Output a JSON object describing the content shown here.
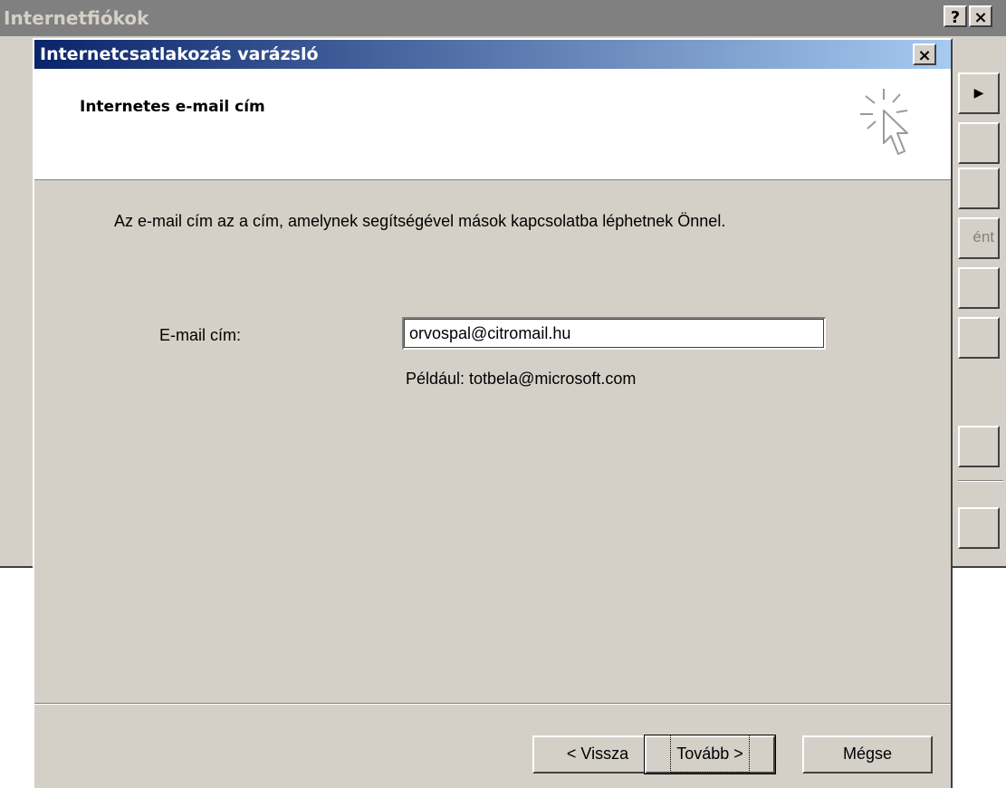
{
  "background_window": {
    "title": "Internetfiókok",
    "help_glyph": "?",
    "close_glyph": "×",
    "arrow_glyph": "▶",
    "partial_button_label": "ént"
  },
  "wizard": {
    "title": "Internetcsatlakozás varázsló",
    "close_glyph": "×",
    "heading": "Internetes e-mail cím",
    "header_icon": "wizard-cursor-sparkle-icon",
    "description": "Az e-mail cím az a cím, amelynek segítségével mások kapcsolatba léphetnek Önnel.",
    "email_label": "E-mail cím:",
    "email_value": "orvospal@citromail.hu",
    "example": "Például: totbela@microsoft.com",
    "buttons": {
      "back": "< Vissza",
      "next": "Tovább >",
      "cancel": "Mégse"
    }
  },
  "colors": {
    "titlebar_active_start": "#0a246a",
    "titlebar_active_end": "#a6caf0",
    "titlebar_inactive": "#808080",
    "face": "#d4d0c8"
  }
}
